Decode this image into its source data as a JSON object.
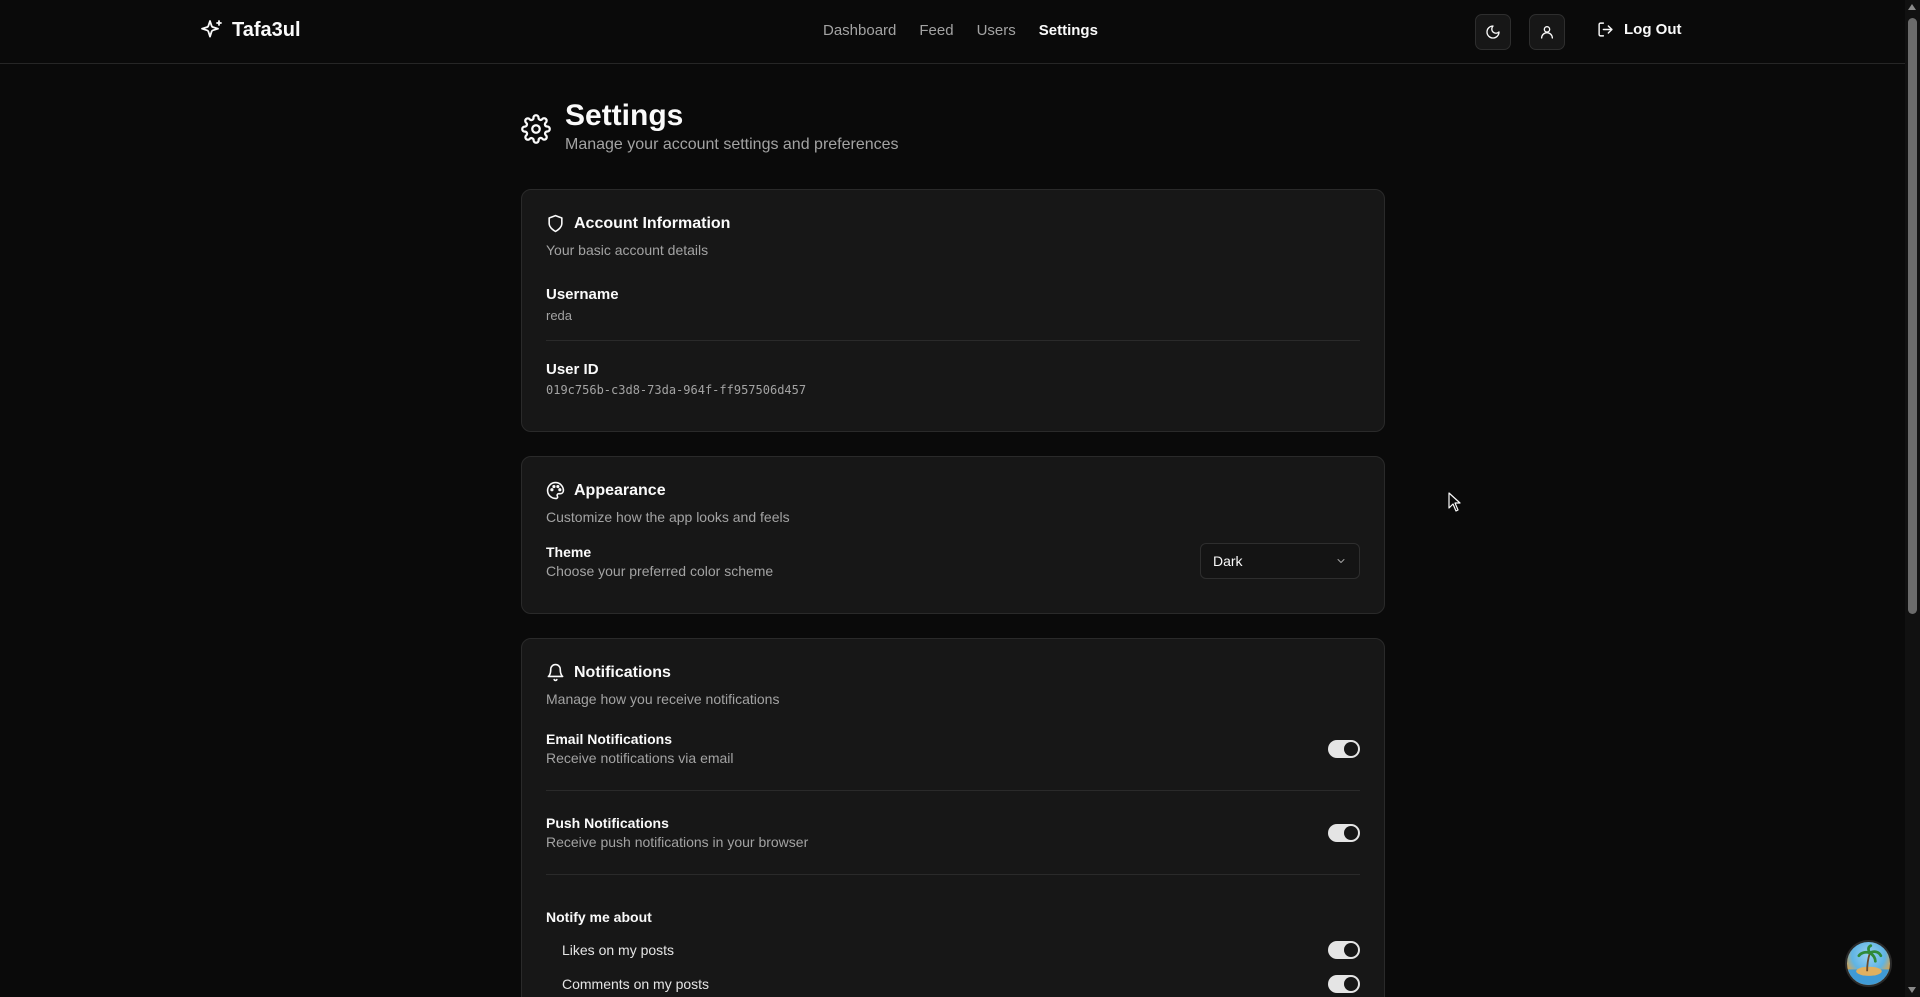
{
  "header": {
    "brand": "Tafa3ul",
    "nav": [
      "Dashboard",
      "Feed",
      "Users",
      "Settings"
    ],
    "active_nav": "Settings",
    "theme_button_icon": "moon-icon",
    "profile_button_icon": "user-icon",
    "logout_label": "Log Out"
  },
  "page": {
    "title": "Settings",
    "subtitle": "Manage your account settings and preferences"
  },
  "account": {
    "title": "Account Information",
    "description": "Your basic account details",
    "username_label": "Username",
    "username_value": "reda",
    "userid_label": "User ID",
    "userid_value": "019c756b-c3d8-73da-964f-ff957506d457"
  },
  "appearance": {
    "title": "Appearance",
    "description": "Customize how the app looks and feels",
    "theme_label": "Theme",
    "theme_sub": "Choose your preferred color scheme",
    "theme_value": "Dark"
  },
  "notifications": {
    "title": "Notifications",
    "description": "Manage how you receive notifications",
    "email_label": "Email Notifications",
    "email_sub": "Receive notifications via email",
    "email_enabled": true,
    "push_label": "Push Notifications",
    "push_sub": "Receive push notifications in your browser",
    "push_enabled": true,
    "notify_about_label": "Notify me about",
    "items": [
      {
        "label": "Likes on my posts",
        "enabled": true
      },
      {
        "label": "Comments on my posts",
        "enabled": true
      }
    ]
  },
  "colors": {
    "background": "#0a0a0a",
    "card": "#171717",
    "border": "#2a2a2a",
    "muted_text": "#a3a3a3",
    "toggle_on": "#e5e5e5"
  }
}
